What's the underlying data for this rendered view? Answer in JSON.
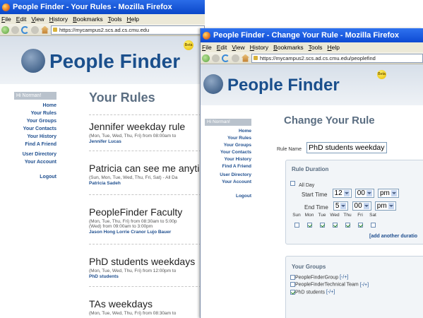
{
  "back_window": {
    "title": "People Finder - Your Rules - Mozilla Firefox",
    "menu": [
      "File",
      "Edit",
      "View",
      "History",
      "Bookmarks",
      "Tools",
      "Help"
    ],
    "url": "https://mycampus2.scs.ad.cs.cmu.edu",
    "logo_text": "People Finder",
    "beta": "Beta",
    "greeting": "Hi Norman!",
    "nav": [
      "Home",
      "Your Rules",
      "Your Groups",
      "Your Contacts",
      "Your History",
      "Find A Friend",
      "User Directory",
      "Your Account",
      "Logout"
    ],
    "heading": "Your Rules",
    "rules": [
      {
        "title": "Jennifer weekday rule",
        "detail": "(Mon, Tue, Wed, Thu, Fri) from 08:00am to",
        "detail2": "",
        "people": "Jennifer Lucas"
      },
      {
        "title": "Patricia can see me anyti",
        "detail": "(Sun, Mon, Tue, Wed, Thu, Fri, Sat) - All Da",
        "detail2": "",
        "people": "Patricia Sadeh"
      },
      {
        "title": "PeopleFinder Faculty",
        "detail": "(Mon, Tue, Thu, Fri) from 08:30am to 5:00p",
        "detail2": "(Wed) from 09:00am to 3:00pm",
        "people": "Jason Hong   Lorrie Cranor   Lujo Bauer"
      },
      {
        "title": "PhD students weekdays",
        "detail": "(Mon, Tue, Wed, Thu, Fri) from 12:00pm to",
        "detail2": "",
        "people": "PhD students"
      },
      {
        "title": "TAs weekdays",
        "detail": "(Mon, Tue, Wed, Thu, Fri) from 08:30am to",
        "detail2": "",
        "people": ""
      }
    ]
  },
  "front_window": {
    "title": "People Finder - Change Your Rule - Mozilla Firefox",
    "menu": [
      "File",
      "Edit",
      "View",
      "History",
      "Bookmarks",
      "Tools",
      "Help"
    ],
    "url": "https://mycampus2.scs.ad.cs.cmu.edu/peoplefind",
    "logo_text": "People Finder",
    "beta": "Beta",
    "greeting": "Hi Norman!",
    "nav": [
      "Home",
      "Your Rules",
      "Your Groups",
      "Your Contacts",
      "Your History",
      "Find A Friend",
      "User Directory",
      "Your Account",
      "Logout"
    ],
    "heading": "Change Your Rule",
    "rule_name_label": "Rule Name",
    "rule_name_value": "PhD students weekday",
    "duration": {
      "heading": "Rule Duration",
      "all_day_label": "All Day",
      "all_day_checked": false,
      "start_label": "Start Time",
      "start_hour": "12",
      "start_min": "00",
      "start_ampm": "pm",
      "end_label": "End Time",
      "end_hour": "5",
      "end_min": "00",
      "end_ampm": "pm",
      "days": [
        {
          "label": "Sun",
          "checked": false
        },
        {
          "label": "Mon",
          "checked": true
        },
        {
          "label": "Tue",
          "checked": true
        },
        {
          "label": "Wed",
          "checked": true
        },
        {
          "label": "Thu",
          "checked": true
        },
        {
          "label": "Fri",
          "checked": true
        },
        {
          "label": "Sat",
          "checked": false
        }
      ],
      "add_link": "[add another duratio"
    },
    "groups": {
      "heading": "Your Groups",
      "items": [
        {
          "label": "PeopleFinderGroup",
          "toggle": "[-/+]",
          "checked": false
        },
        {
          "label": "PeopleFinderTechnical Team",
          "toggle": "[-/+]",
          "checked": false
        },
        {
          "label": "PhD students",
          "toggle": "[-/+]",
          "checked": true
        }
      ]
    }
  }
}
